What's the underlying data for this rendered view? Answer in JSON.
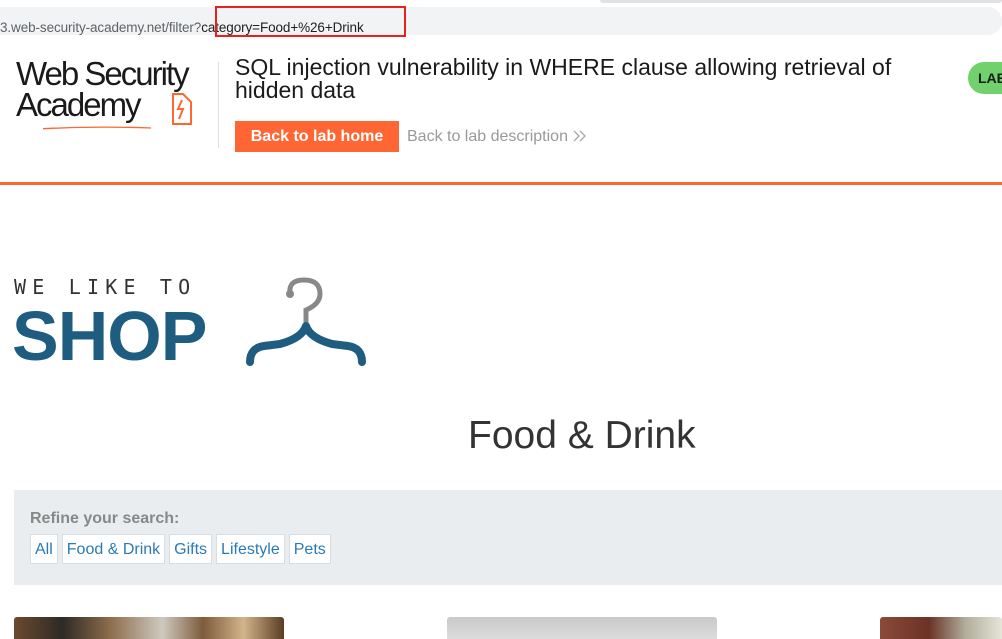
{
  "browser": {
    "url_base": "3.web-security-academy.net/filter?",
    "url_query": "category=Food+%26+Drink"
  },
  "lab": {
    "logo_line1": "Web Security",
    "logo_line2": "Academy",
    "title": "SQL injection vulnerability in WHERE clause allowing retrieval of hidden data",
    "back_home_label": "Back to lab home",
    "back_description_label": "Back to lab description",
    "status_label": "LAB"
  },
  "shop": {
    "tagline": "WE LIKE TO",
    "brand": "SHOP"
  },
  "page": {
    "category_heading": "Food & Drink"
  },
  "filter": {
    "label": "Refine your search:",
    "categories": [
      "All",
      "Food & Drink",
      "Gifts",
      "Lifestyle",
      "Pets"
    ]
  },
  "colors": {
    "accent": "#ff6633",
    "brand_blue": "#1e5d80",
    "link_blue": "#2a7ab8",
    "status_green": "#70d16d",
    "highlight_red": "#e8211f"
  }
}
